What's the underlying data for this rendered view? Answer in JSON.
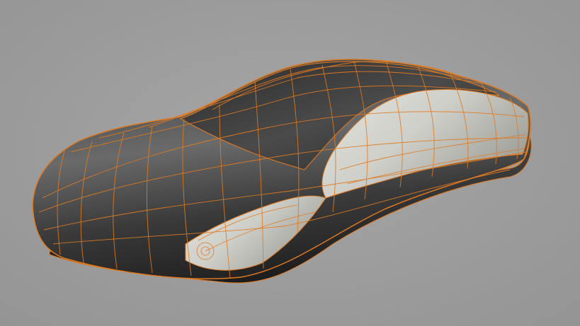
{
  "viewport": {
    "background_color": "#a0a0a0",
    "body_dark_color": "#2e2e2e",
    "body_mid_color": "#5a5a5a",
    "panel_light_color": "#d2d2cc",
    "wireframe_color": "#e07a20"
  }
}
